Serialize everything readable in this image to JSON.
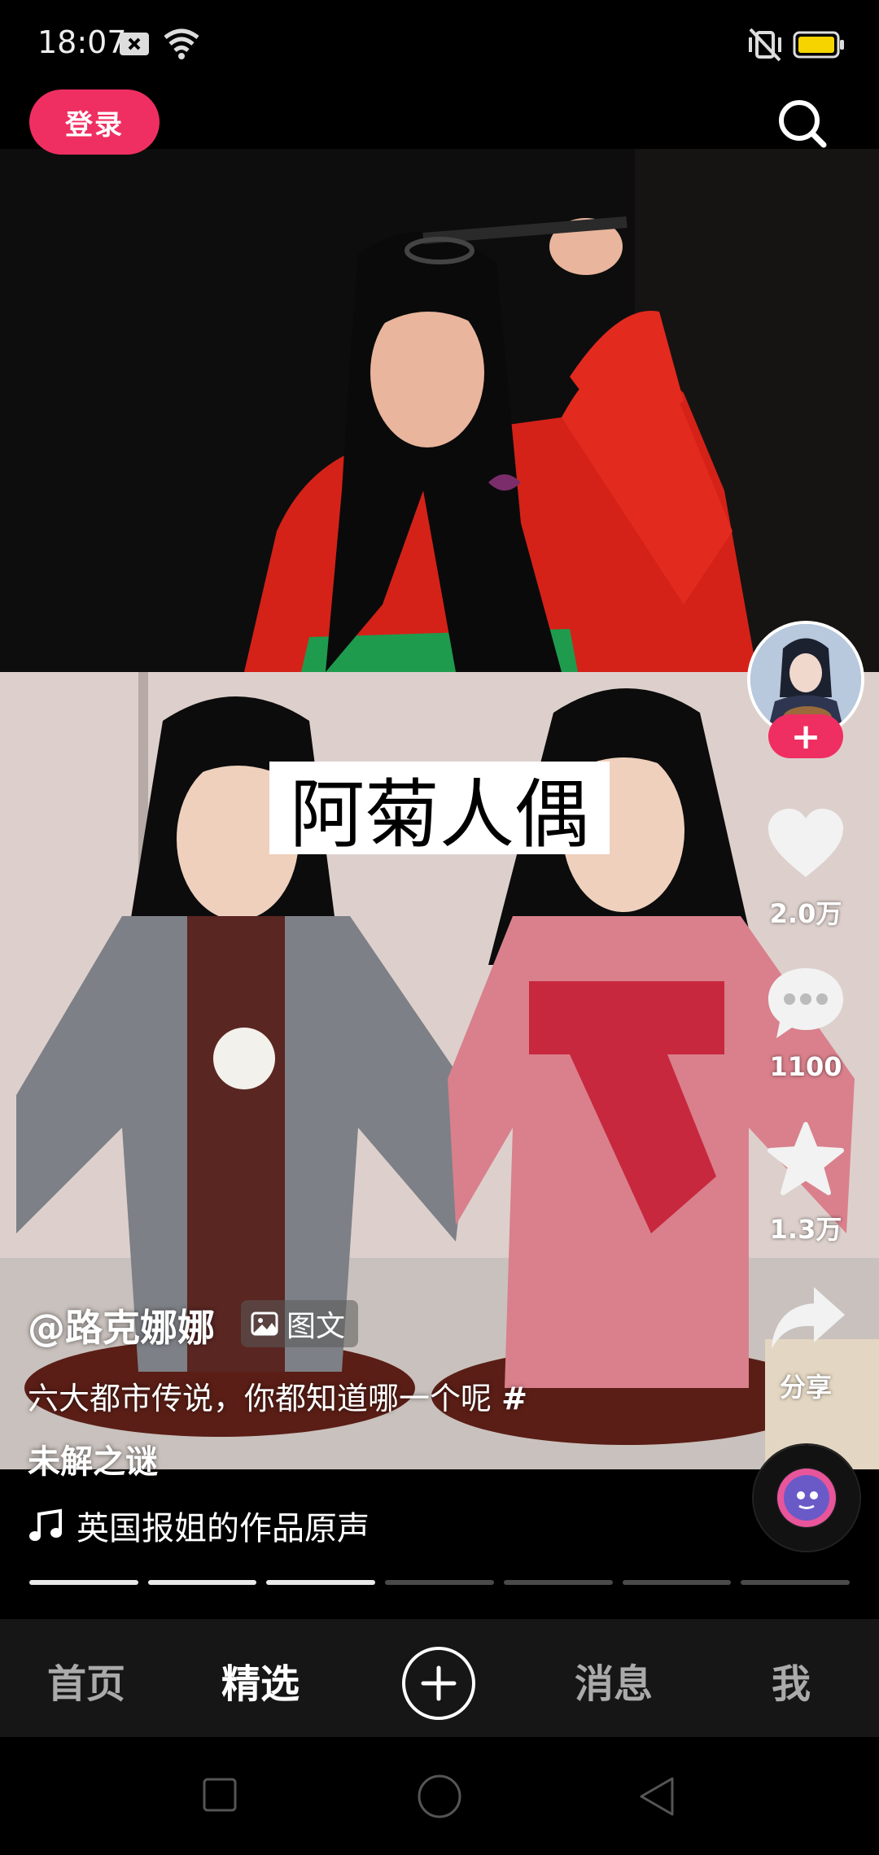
{
  "status_bar": {
    "time": "18:07",
    "icons": [
      "notification-x-icon",
      "wifi-icon",
      "vibrate-off-icon",
      "battery-icon"
    ],
    "battery_color": "#f5d400"
  },
  "top_bar": {
    "login_label": "登录",
    "search_icon": "search-icon",
    "accent_color": "#ef2f62"
  },
  "post": {
    "overlay_title": "阿菊人偶",
    "author": "@路克娜娜",
    "post_type": "图文",
    "caption": "六大都市传说，你都知道哪一个呢",
    "hashtag_mark": "#",
    "hashtag_text": "未解之谜",
    "music": "英国报姐的作品原声",
    "progress": {
      "total": 7,
      "viewed": 3
    }
  },
  "actions": {
    "follow_label": "+",
    "likes": "2.0万",
    "comments": "1100",
    "favorites": "1.3万",
    "share_label": "分享"
  },
  "bottom_nav": {
    "items": [
      "首页",
      "精选",
      "消息",
      "我"
    ],
    "active": "精选",
    "create_icon": "plus-circle-icon"
  },
  "system_nav": {
    "icons": [
      "recents-square-icon",
      "home-circle-icon",
      "back-triangle-icon"
    ]
  }
}
